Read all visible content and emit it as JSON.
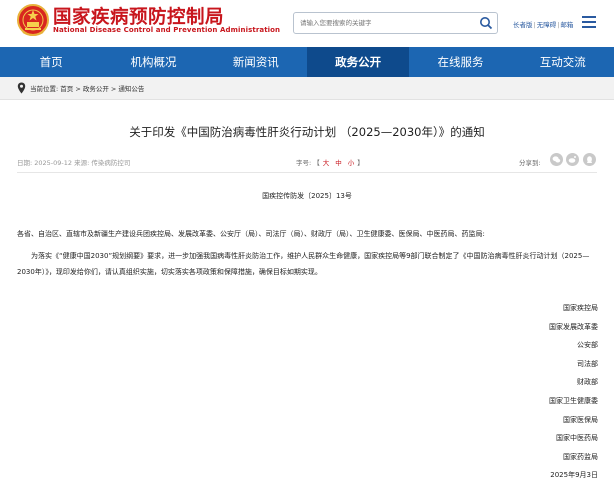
{
  "header": {
    "logo_cn": "国家疾病预防控制局",
    "logo_en": "National Disease Control and Prevention Administration",
    "search_placeholder": "请输入您要搜索的关键字",
    "links": [
      "长者版",
      "无障碍",
      "邮箱"
    ],
    "brand_red": "#c8161d"
  },
  "nav": {
    "items": [
      "首页",
      "机构概况",
      "新闻资讯",
      "政务公开",
      "在线服务",
      "互动交流"
    ],
    "active_index": 3,
    "color": "#1c66b2",
    "active_color": "#0e4a8c"
  },
  "breadcrumb": "当前位置:  首页 > 政务公开 > 通知公告",
  "article": {
    "title": "关于印发《中国防治病毒性肝炎行动计划 （2025—2030年）》的通知",
    "meta": "日期:  2025-09-12 来源:  传染病防控司",
    "font_size_label": "字号:",
    "font_size_options": [
      "大",
      "中",
      "小"
    ],
    "share_label": "分享到:",
    "doc_number": "国疾控传防发〔2025〕13号",
    "addressee": "各省、自治区、直辖市及新疆生产建设兵团疾控局、发展改革委、公安厅（局）、司法厅（局）、财政厅（局）、卫生健康委、医保局、中医药局、药监局:",
    "paragraph": "为落实《“健康中国2030”规划纲要》要求，进一步加强我国病毒性肝炎防治工作，维护人民群众生命健康，国家疾控局等9部门联合制定了《中国防治病毒性肝炎行动计划（2025—2030年）》，现印发给你们，请认真组织实施，切实落实各项政策和保障措施，确保目标如期实现。",
    "signers": [
      "国家疾控局",
      "国家发展改革委",
      "公安部",
      "司法部",
      "财政部",
      "国家卫生健康委",
      "国家医保局",
      "国家中医药局",
      "国家药监局",
      "2025年9月3日"
    ]
  }
}
